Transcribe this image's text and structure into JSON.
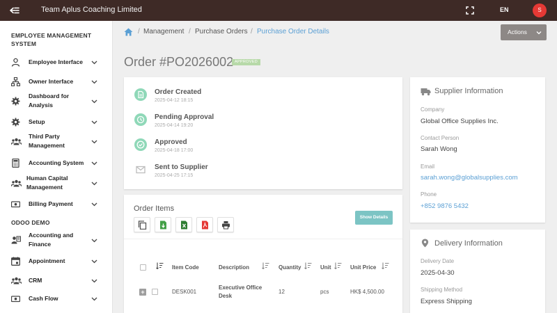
{
  "topbar": {
    "company": "Team Aplus Coaching Limited",
    "language": "EN",
    "avatar_letter": "S",
    "avatar_color": "#e53935",
    "bar_color": "#3e2a26"
  },
  "sidebar": {
    "section1_title": "EMPLOYEE MANAGEMENT SYSTEM",
    "section2_title": "ODOO DEMO",
    "items": [
      {
        "label": "Employee Interface",
        "icon": "person-icon"
      },
      {
        "label": "Owner Interface",
        "icon": "org-chart-icon"
      },
      {
        "label": "Dashboard for Analysis",
        "icon": "gear-icon"
      },
      {
        "label": "Setup",
        "icon": "gear-icon"
      },
      {
        "label": "Third Party Management",
        "icon": "people-icon"
      },
      {
        "label": "Accounting System",
        "icon": "calculator-icon"
      },
      {
        "label": "Human Capital Management",
        "icon": "people-icon"
      },
      {
        "label": "Billing Payment",
        "icon": "money-icon"
      },
      {
        "label": "Accounting and Finance",
        "icon": "contact-card-icon"
      },
      {
        "label": "Appointment",
        "icon": "calendar-icon"
      },
      {
        "label": "CRM",
        "icon": "people-icon"
      },
      {
        "label": "Cash Flow",
        "icon": "money-icon"
      }
    ]
  },
  "breadcrumb": {
    "items": [
      "Management",
      "Purchase Orders",
      "Purchase Order Details"
    ],
    "separator": "/"
  },
  "actions_label": "Actions",
  "order": {
    "title": "Order #PO2026002",
    "status_badge": "APPROVED",
    "badge_color": "#b7d9a8"
  },
  "timeline": [
    {
      "title": "Order Created",
      "date": "2025-04-12 18:15",
      "icon": "document-icon",
      "color": "#8fd8b8"
    },
    {
      "title": "Pending Approval",
      "date": "2025-04-14 19:20",
      "icon": "clock-icon",
      "color": "#8fd8b8"
    },
    {
      "title": "Approved",
      "date": "2025-04-18 17:00",
      "icon": "check-circle-icon",
      "color": "#8fd8b8"
    },
    {
      "title": "Sent to Supplier",
      "date": "2025-04-25 17:15",
      "icon": "mail-icon",
      "color": "#bdbdbd"
    }
  ],
  "order_items": {
    "title": "Order Items",
    "toolbar_icons": [
      "copy-icon",
      "csv-export-icon",
      "excel-export-icon",
      "pdf-export-icon",
      "print-icon"
    ],
    "show_details_label": "Show Details",
    "columns": [
      "Item Code",
      "Description",
      "Quantity",
      "Unit",
      "Unit Price"
    ],
    "rows": [
      {
        "code": "DESK001",
        "description": "Executive Office Desk",
        "quantity": "12",
        "unit": "pcs",
        "unit_price": "HK$ 4,500.00"
      }
    ]
  },
  "supplier": {
    "heading": "Supplier Information",
    "company_label": "Company",
    "company": "Global Office Supplies Inc.",
    "contact_label": "Contact Person",
    "contact": "Sarah Wong",
    "email_label": "Email",
    "email": "sarah.wong@globalsupplies.com",
    "phone_label": "Phone",
    "phone": "+852 9876 5432",
    "link_color": "#5a9fd4"
  },
  "delivery": {
    "heading": "Delivery Information",
    "date_label": "Delivery Date",
    "date": "2025-04-30",
    "method_label": "Shipping Method",
    "method": "Express Shipping"
  }
}
